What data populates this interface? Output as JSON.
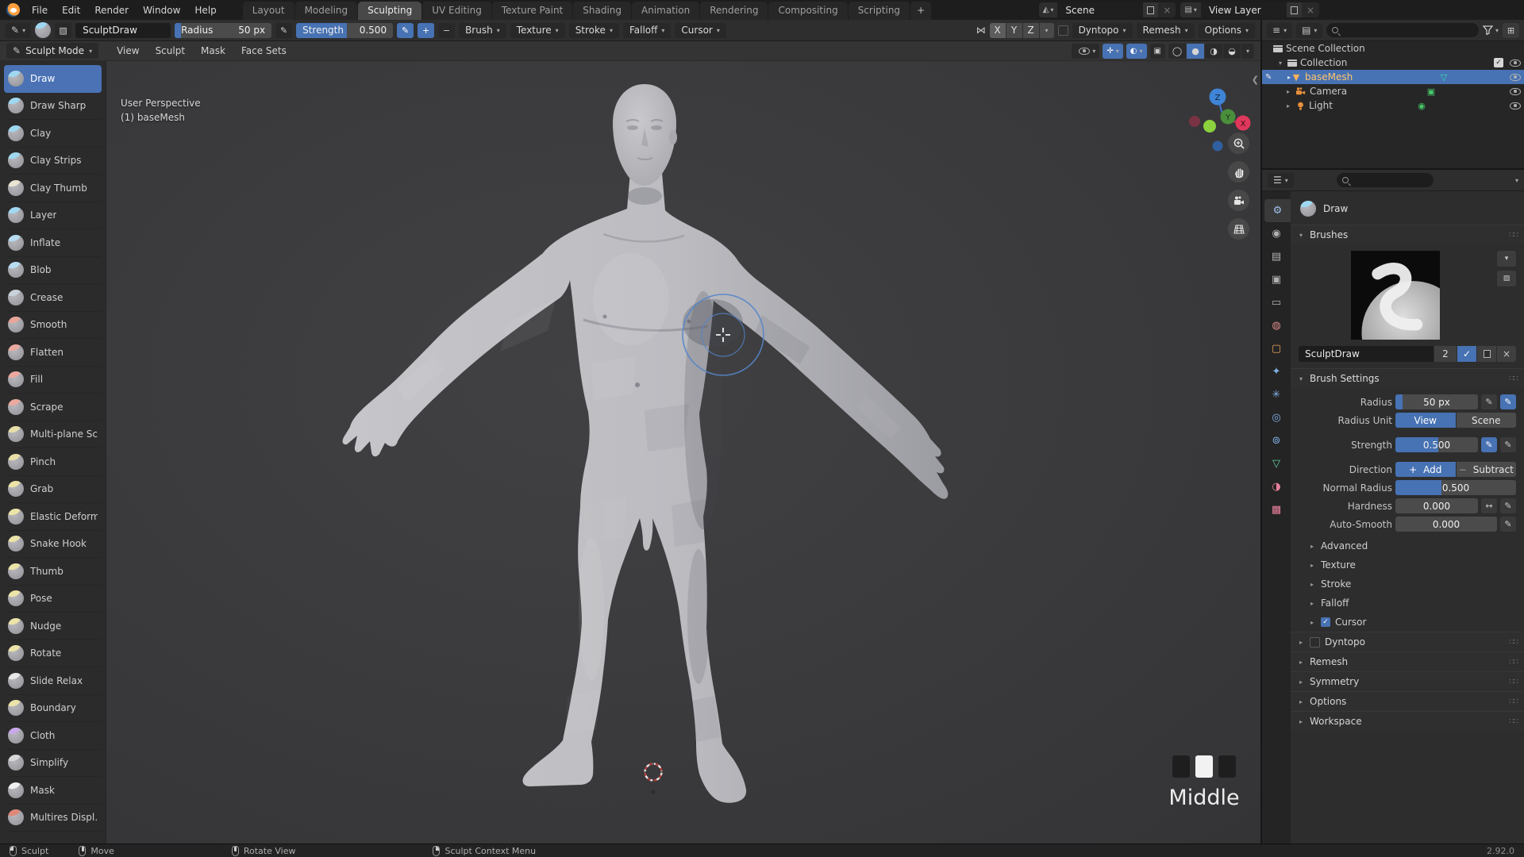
{
  "app": {
    "version": "2.92.0"
  },
  "menubar": {
    "menus": [
      "File",
      "Edit",
      "Render",
      "Window",
      "Help"
    ],
    "workspaces": [
      {
        "label": "Layout"
      },
      {
        "label": "Modeling"
      },
      {
        "label": "Sculpting",
        "cls": "active"
      },
      {
        "label": "UV Editing"
      },
      {
        "label": "Texture Paint"
      },
      {
        "label": "Shading"
      },
      {
        "label": "Animation"
      },
      {
        "label": "Rendering"
      },
      {
        "label": "Compositing"
      },
      {
        "label": "Scripting"
      }
    ],
    "add_tab": "+",
    "scene": "Scene",
    "view_layer": "View Layer"
  },
  "tool_settings": {
    "brush_name": "SculptDraw",
    "radius_label": "Radius",
    "radius_value": "50 px",
    "strength_label": "Strength",
    "strength_value": "0.500",
    "plus": "+",
    "minus": "−",
    "dropdowns": [
      "Brush",
      "Texture",
      "Stroke",
      "Falloff",
      "Cursor"
    ],
    "mirror_axes": [
      {
        "label": "X",
        "cls": "first"
      },
      {
        "label": "Y"
      },
      {
        "label": "Z"
      }
    ],
    "dyntopo": "Dyntopo",
    "remesh": "Remesh",
    "options": "Options"
  },
  "viewport": {
    "mode": "Sculpt Mode",
    "menus": [
      "View",
      "Sculpt",
      "Mask",
      "Face Sets"
    ],
    "overlay_line1": "User Perspective",
    "overlay_line2": "(1) baseMesh",
    "axis_x": "X",
    "axis_y": "Y",
    "axis_z": "Z",
    "screencast_key": "Middle"
  },
  "brush_toolbar": [
    {
      "label": "Draw",
      "accent": "#9fd8f0",
      "cls": "selected"
    },
    {
      "label": "Draw Sharp",
      "accent": "#9fd8f0"
    },
    {
      "label": "Clay",
      "accent": "#9fd8f0"
    },
    {
      "label": "Clay Strips",
      "accent": "#9fd8f0"
    },
    {
      "label": "Clay Thumb",
      "accent": "#e9e4d2"
    },
    {
      "label": "Layer",
      "accent": "#9fd8f0"
    },
    {
      "label": "Inflate",
      "accent": "#b8dcf2"
    },
    {
      "label": "Blob",
      "accent": "#b8dcf2"
    },
    {
      "label": "Crease",
      "accent": "#c9d2da"
    },
    {
      "label": "Smooth",
      "accent": "#e8a598"
    },
    {
      "label": "Flatten",
      "accent": "#eba9a0"
    },
    {
      "label": "Fill",
      "accent": "#eba9a0"
    },
    {
      "label": "Scrape",
      "accent": "#eba9a0"
    },
    {
      "label": "Multi-plane Sc…",
      "accent": "#e8dfa8"
    },
    {
      "label": "Pinch",
      "accent": "#e8dfa8"
    },
    {
      "label": "Grab",
      "accent": "#ece3a8"
    },
    {
      "label": "Elastic Deform",
      "accent": "#ece3a8"
    },
    {
      "label": "Snake Hook",
      "accent": "#ece3a8"
    },
    {
      "label": "Thumb",
      "accent": "#ece3a8"
    },
    {
      "label": "Pose",
      "accent": "#ece3a8"
    },
    {
      "label": "Nudge",
      "accent": "#ece3a8"
    },
    {
      "label": "Rotate",
      "accent": "#ece3a8"
    },
    {
      "label": "Slide Relax",
      "accent": "#e8e8e8"
    },
    {
      "label": "Boundary",
      "accent": "#ece3a8"
    },
    {
      "label": "Cloth",
      "accent": "#c8a8e8"
    },
    {
      "label": "Simplify",
      "accent": "#d8d8d8"
    },
    {
      "label": "Mask",
      "accent": "#f0f0f0"
    },
    {
      "label": "Multires Displ…",
      "accent": "#e08878"
    }
  ],
  "outliner": {
    "scene_collection": "Scene Collection",
    "collection": "Collection",
    "basemesh": "baseMesh",
    "camera": "Camera",
    "light": "Light"
  },
  "properties": {
    "tool_title": "Draw",
    "tabs": [
      {
        "glyph": "⚙",
        "color": "#9ec1e8",
        "cls": "active"
      },
      {
        "glyph": "◉",
        "color": "#b0b0b0"
      },
      {
        "glyph": "▤",
        "color": "#b0b0b0"
      },
      {
        "glyph": "▣",
        "color": "#b0b0b0"
      },
      {
        "glyph": "▭",
        "color": "#b0b0b0"
      },
      {
        "glyph": "◍",
        "color": "#d88a8a"
      },
      {
        "glyph": "▢",
        "color": "#e8a05a"
      },
      {
        "glyph": "✦",
        "color": "#7fb2e5"
      },
      {
        "glyph": "✳",
        "color": "#7fb2e5"
      },
      {
        "glyph": "◎",
        "color": "#7fb2e5"
      },
      {
        "glyph": "⊚",
        "color": "#7fb2e5"
      },
      {
        "glyph": "▽",
        "color": "#5fd3a2"
      },
      {
        "glyph": "◑",
        "color": "#e87f9c"
      },
      {
        "glyph": "▩",
        "color": "#e87f9c"
      }
    ],
    "brushes_panel": "Brushes",
    "brush_name": "SculptDraw",
    "brush_users": "2",
    "settings_panel": "Brush Settings",
    "settings": {
      "radius_label": "Radius",
      "radius_value": "50 px",
      "radius_unit_label": "Radius Unit",
      "radius_unit_view": "View",
      "radius_unit_scene": "Scene",
      "strength_label": "Strength",
      "strength_value": "0.500",
      "direction_label": "Direction",
      "dir_add": "Add",
      "dir_subtract": "Subtract",
      "plus": "+",
      "minus": "−",
      "arrows": "↔",
      "normal_radius_label": "Normal Radius",
      "normal_radius_value": "0.500",
      "hardness_label": "Hardness",
      "hardness_value": "0.000",
      "auto_smooth_label": "Auto-Smooth",
      "auto_smooth_value": "0.000"
    },
    "sub_panels": [
      {
        "label": "Advanced"
      },
      {
        "label": "Texture"
      },
      {
        "label": "Stroke"
      },
      {
        "label": "Falloff"
      },
      {
        "label": "Cursor",
        "cls": "has-cb",
        "checked": "✓"
      }
    ],
    "main_panels": [
      {
        "label": "Dyntopo",
        "cls": "has-cb"
      },
      {
        "label": "Remesh"
      },
      {
        "label": "Symmetry"
      },
      {
        "label": "Options"
      },
      {
        "label": "Workspace"
      }
    ]
  },
  "statusbar": {
    "items": [
      {
        "label": "Sculpt",
        "cls": "m-left"
      },
      {
        "label": "Move",
        "cls": "m-mid"
      },
      {
        "label": "Rotate View",
        "cls": "m-mid gap1"
      },
      {
        "label": "Sculpt Context Menu",
        "cls": "m-right gap2"
      }
    ],
    "version": "2.92.0"
  },
  "colors": {
    "accent": "#4772b3",
    "selected_object_text": "#ffc46e",
    "object_icon_orange": "#e8913d",
    "data_icon_green": "#3dd6a4"
  }
}
